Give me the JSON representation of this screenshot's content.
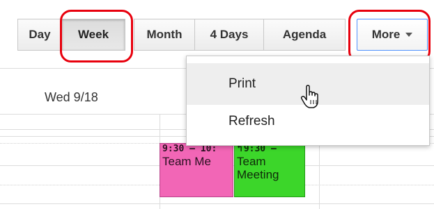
{
  "toolbar": {
    "views": [
      {
        "label": "Day"
      },
      {
        "label": "Week"
      },
      {
        "label": "Month"
      },
      {
        "label": "4 Days"
      },
      {
        "label": "Agenda"
      }
    ],
    "more_label": "More",
    "active_view": "Week"
  },
  "day_header": "Wed 9/18",
  "more_menu": {
    "items": [
      {
        "label": "Print",
        "hovered": true
      },
      {
        "label": "Refresh",
        "hovered": false
      }
    ]
  },
  "events": [
    {
      "time": "9:30 – 10:",
      "title": "Team Me",
      "color": "#f266b6"
    },
    {
      "time": "9:30 –",
      "title": "Team Meeting",
      "color": "#3cd62a"
    }
  ],
  "icons": {
    "caret": "chevron-down-icon",
    "reply": "reply-arrow-icon",
    "cursor": "hand-pointer-icon"
  },
  "colors": {
    "highlight": "#e8000d",
    "focus_border": "#4d90fe"
  }
}
